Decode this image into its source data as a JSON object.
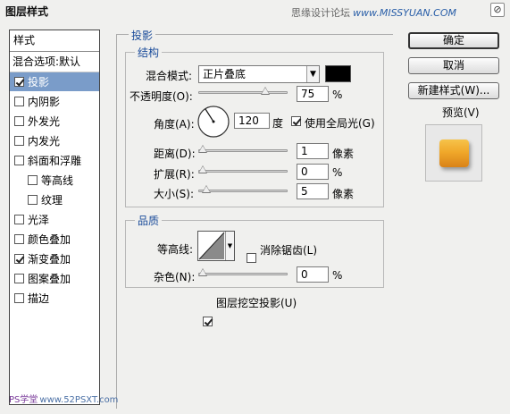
{
  "window": {
    "title": "图层样式",
    "watermark_text": "思缘设计论坛",
    "watermark_url": "www.MISSYUAN.COM",
    "close_glyph": "⊘"
  },
  "style_list": {
    "header": "样式",
    "blend_options": "混合选项:默认",
    "items": [
      {
        "label": "投影",
        "checked": true,
        "active": true,
        "sub": false
      },
      {
        "label": "内阴影",
        "checked": false,
        "active": false,
        "sub": false
      },
      {
        "label": "外发光",
        "checked": false,
        "active": false,
        "sub": false
      },
      {
        "label": "内发光",
        "checked": false,
        "active": false,
        "sub": false
      },
      {
        "label": "斜面和浮雕",
        "checked": false,
        "active": false,
        "sub": false
      },
      {
        "label": "等高线",
        "checked": false,
        "active": false,
        "sub": true
      },
      {
        "label": "纹理",
        "checked": false,
        "active": false,
        "sub": true
      },
      {
        "label": "光泽",
        "checked": false,
        "active": false,
        "sub": false
      },
      {
        "label": "颜色叠加",
        "checked": false,
        "active": false,
        "sub": false
      },
      {
        "label": "渐变叠加",
        "checked": true,
        "active": false,
        "sub": false
      },
      {
        "label": "图案叠加",
        "checked": false,
        "active": false,
        "sub": false
      },
      {
        "label": "描边",
        "checked": false,
        "active": false,
        "sub": false
      }
    ]
  },
  "panel": {
    "title": "投影",
    "structure": {
      "legend": "结构",
      "blend_mode_label": "混合模式:",
      "blend_mode_value": "正片叠底",
      "shadow_color": "#000000",
      "opacity_label": "不透明度(O):",
      "opacity_value": "75",
      "opacity_unit": "%",
      "opacity_level": 0.75,
      "angle_label": "角度(A):",
      "angle_value": "120",
      "angle_unit": "度",
      "global_light_label": "使用全局光(G)",
      "global_light_checked": true,
      "distance_label": "距离(D):",
      "distance_value": "1",
      "distance_unit": "像素",
      "spread_label": "扩展(R):",
      "spread_value": "0",
      "spread_unit": "%",
      "size_label": "大小(S):",
      "size_value": "5",
      "size_unit": "像素"
    },
    "quality": {
      "legend": "品质",
      "contour_label": "等高线:",
      "anti_alias_label": "消除锯齿(L)",
      "anti_alias_checked": false,
      "noise_label": "杂色(N):",
      "noise_value": "0",
      "noise_unit": "%"
    },
    "knockout_label": "图层挖空投影(U)",
    "knockout_checked": true
  },
  "actions": {
    "ok": "确定",
    "cancel": "取消",
    "new_style": "新建样式(W)...",
    "preview_label": "预览(V)",
    "preview_checked": true
  },
  "footer": {
    "site_text": "PS学堂",
    "site_url": "www.52PSXT.com"
  }
}
